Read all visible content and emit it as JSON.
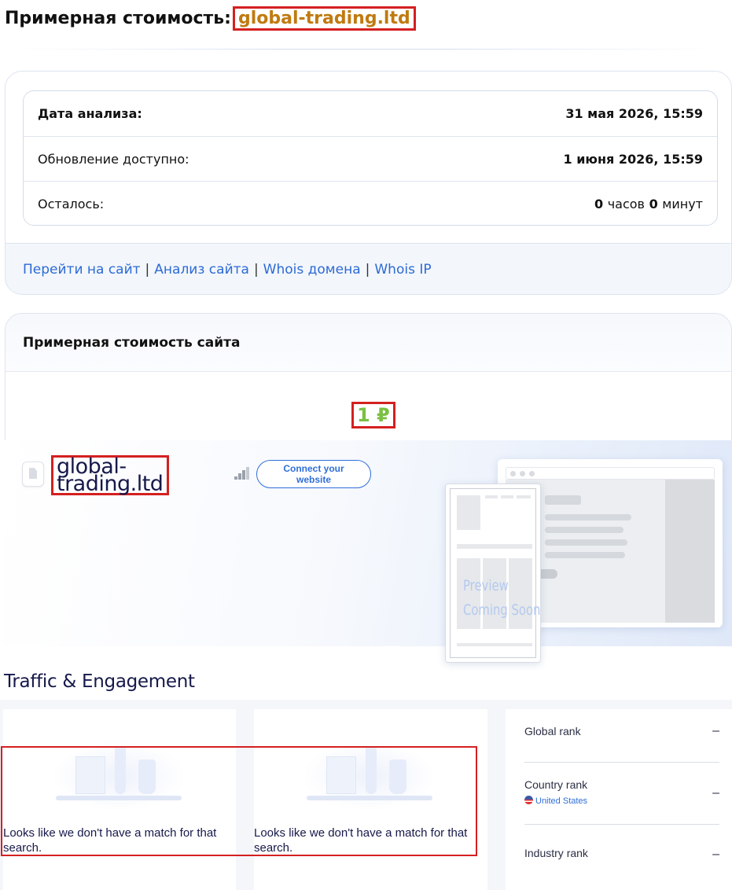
{
  "header": {
    "title_prefix": "Примерная стоимость:",
    "domain": "global-trading.ltd"
  },
  "info": {
    "rows": [
      {
        "label": "Дата анализа:",
        "value": "31 мая 2026, 15:59"
      },
      {
        "label": "Обновление доступно:",
        "value": "1 июня 2026, 15:59"
      },
      {
        "label": "Осталось:",
        "hours": "0",
        "hours_unit": "часов",
        "minutes": "0",
        "minutes_unit": "минут"
      }
    ]
  },
  "links": {
    "goto_site": "Перейти на сайт",
    "site_analysis": "Анализ сайта",
    "whois_domain": "Whois домена",
    "whois_ip": "Whois IP",
    "separator": "|"
  },
  "value_card": {
    "title": "Примерная стоимость сайта",
    "price": "1 ₽"
  },
  "similarweb": {
    "site_name": "global-trading.ltd",
    "connect_button": "Connect your website",
    "preview_line1": "Preview",
    "preview_line2": "Coming Soon",
    "section_title": "Traffic & Engagement",
    "no_match_text": "Looks like we don't have a match for that search.",
    "ranks": [
      {
        "label": "Global rank",
        "value": "–"
      },
      {
        "label": "Country rank",
        "value": "–",
        "country": "United States"
      },
      {
        "label": "Industry rank",
        "value": "–"
      }
    ]
  },
  "colors": {
    "link": "#2c6bd6",
    "highlight_border": "#d42020",
    "domain_text": "#c07a10",
    "price_text": "#7bbf44",
    "accent_blue": "#2f6ed8"
  }
}
